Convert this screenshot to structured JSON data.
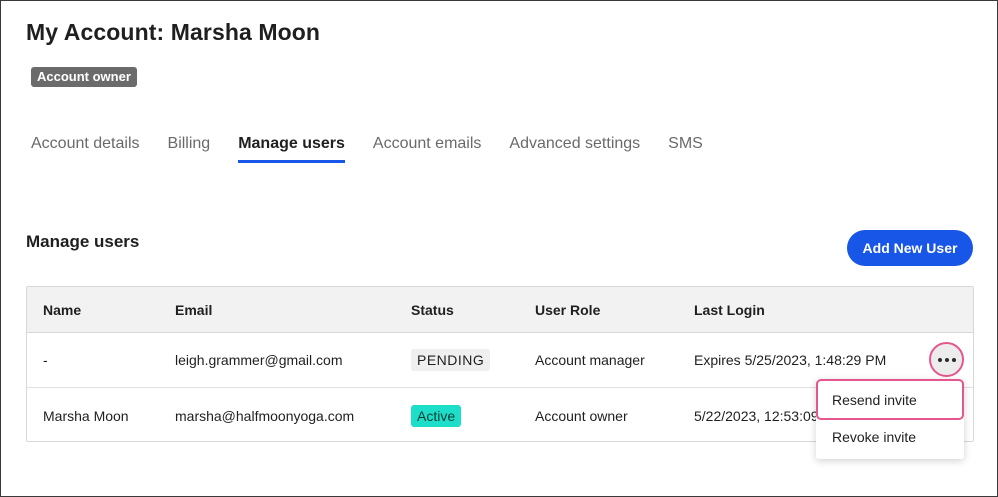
{
  "header": {
    "title": "My Account: Marsha Moon",
    "badge": "Account owner"
  },
  "tabs": [
    {
      "label": "Account details",
      "active": false
    },
    {
      "label": "Billing",
      "active": false
    },
    {
      "label": "Manage users",
      "active": true
    },
    {
      "label": "Account emails",
      "active": false
    },
    {
      "label": "Advanced settings",
      "active": false
    },
    {
      "label": "SMS",
      "active": false
    }
  ],
  "section": {
    "title": "Manage users",
    "add_button": "Add New User"
  },
  "table": {
    "columns": [
      "Name",
      "Email",
      "Status",
      "User Role",
      "Last Login"
    ],
    "rows": [
      {
        "name": "-",
        "email": "leigh.grammer@gmail.com",
        "status": "PENDING",
        "role": "Account manager",
        "last_login": "Expires 5/25/2023, 1:48:29 PM"
      },
      {
        "name": "Marsha Moon",
        "email": "marsha@halfmoonyoga.com",
        "status": "Active",
        "role": "Account owner",
        "last_login": "5/22/2023, 12:53:09"
      }
    ]
  },
  "row_menu": {
    "items": [
      "Resend invite",
      "Revoke invite"
    ]
  },
  "colors": {
    "accent": "#1856e8",
    "highlight": "#e5568f",
    "active_badge": "#1ddfc9"
  }
}
